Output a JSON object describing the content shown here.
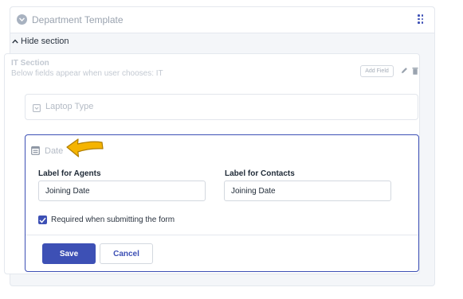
{
  "header": {
    "title": "Department Template",
    "icon": "chevron-circle-icon",
    "drag_icon": "drag-handle-icon"
  },
  "toggle": {
    "label": "Hide section",
    "icon": "chevron-up-icon"
  },
  "section": {
    "title": "IT Section",
    "description": "Below fields appear when user chooses: IT",
    "add_field_label": "Add Field",
    "edit_icon": "pencil-icon",
    "delete_icon": "trash-icon"
  },
  "fields": {
    "laptop": {
      "label": "Laptop Type",
      "icon": "dropdown-field-icon"
    },
    "date": {
      "label": "Date",
      "icon": "calendar-icon",
      "pointer_icon": "pointing-arrow-icon",
      "agents_label": "Label for Agents",
      "agents_value": "Joining Date",
      "contacts_label": "Label for Contacts",
      "contacts_value": "Joining Date",
      "required_label": "Required when submitting the form",
      "required_checked": true
    }
  },
  "actions": {
    "save_label": "Save",
    "cancel_label": "Cancel"
  },
  "colors": {
    "accent": "#3d50b5",
    "arrow": "#f5b400",
    "muted_text": "#b4bbc5",
    "border": "#e4e8ee"
  }
}
